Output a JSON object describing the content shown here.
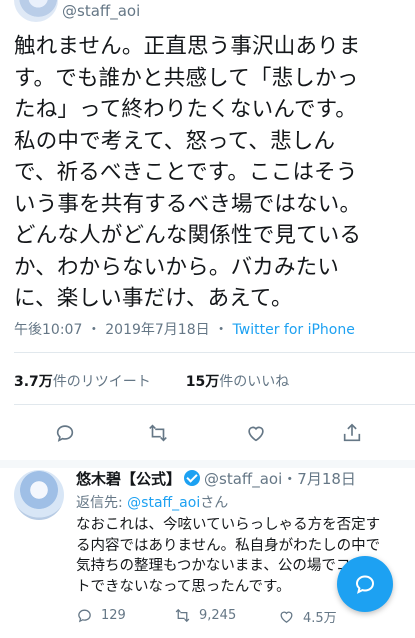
{
  "tweet": {
    "handle": "@staff_aoi",
    "text": "触れません。正直思う事沢山ありま\nす。でも誰かと共感して「悲しかっ\nたね」って終わりたくないんです。\n私の中で考えて、怒って、悲しん\nで、祈るべきことです。ここはそう\nいう事を共有するべき場ではない。\nどんな人がどんな関係性で見ている\nか、わからないから。バカみたい\nに、楽しい事だけ、あえて。",
    "time": "午後10:07",
    "date": "2019年7月18日",
    "separator": "・",
    "source": "Twitter for iPhone",
    "retweets_count": "3.7万",
    "retweets_label": "件のリツイート",
    "likes_count": "15万",
    "likes_label": "件のいいね"
  },
  "reply": {
    "name": "悠木碧【公式】",
    "handle": "@staff_aoi",
    "date": "・7月18日",
    "replying_prefix": "返信先: ",
    "replying_handle": "@staff_aoi",
    "replying_suffix": "さん",
    "text": "なおこれは、今呟いていらっしゃる方を否定す\nる内容ではありません。私自身がわたしの中で\n気持ちの整理もつかないまま、公の場でコメン\nトできないなって思ったんです。",
    "replies": "129",
    "retweets": "9,245",
    "likes": "4.5万"
  },
  "icons": {
    "reply": "reply-icon",
    "retweet": "retweet-icon",
    "like": "heart-icon",
    "share": "share-icon",
    "compose": "compose-icon"
  },
  "colors": {
    "accent": "#1da1f2",
    "text": "#14171a",
    "secondary": "#657786",
    "divider": "#e1e8ed"
  }
}
